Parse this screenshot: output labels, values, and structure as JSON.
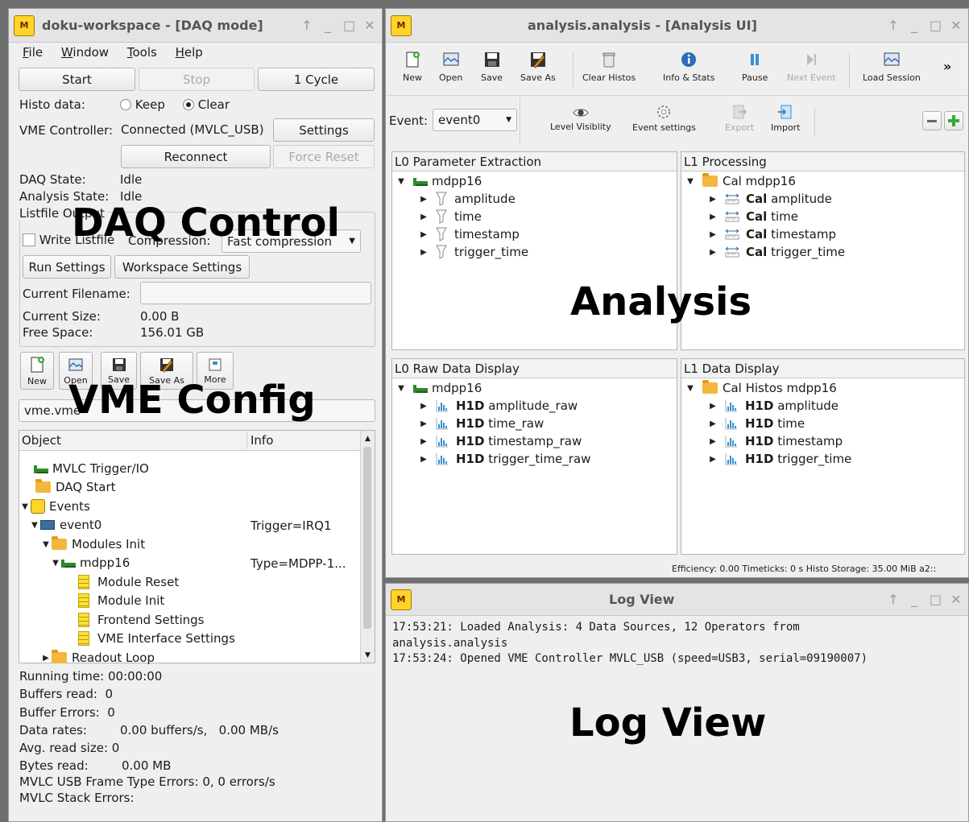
{
  "daq_window": {
    "title": "doku-workspace - [DAQ mode]",
    "logo": "MVME",
    "menu": [
      "File",
      "Window",
      "Tools",
      "Help"
    ],
    "start": "Start",
    "stop": "Stop",
    "one_cycle": "1 Cycle",
    "histo_label": "Histo data:",
    "keep": "Keep",
    "clear": "Clear",
    "vme_label": "VME Controller:",
    "vme_status": "Connected (MVLC_USB)",
    "settings": "Settings",
    "reconnect": "Reconnect",
    "force_reset": "Force Reset",
    "daq_state_label": "DAQ State:",
    "daq_state": "Idle",
    "analysis_state_label": "Analysis State:",
    "analysis_state": "Idle",
    "listfile_output": "Listfile Output",
    "overlay_daq": "DAQ Control",
    "write_listfile": "Write Listfile",
    "compression_label": "Compression:",
    "compression_value": "Fast compression",
    "run_settings": "Run Settings",
    "workspace_settings": "Workspace Settings",
    "current_filename_label": "Current Filename:",
    "current_filename": "",
    "current_size_label": "Current Size:",
    "current_size": "0.00 B",
    "free_space_label": "Free Space:",
    "free_space": "156.01 GB",
    "toolbar": [
      "New",
      "Open",
      "Save",
      "Save As",
      "More"
    ],
    "overlay_vme": "VME Config",
    "config_file": "vme.vme",
    "tree_header_object": "Object",
    "tree_header_info": "Info",
    "tree": [
      {
        "label": "MVLC Trigger/IO",
        "info": ""
      },
      {
        "label": "DAQ Start",
        "info": ""
      },
      {
        "label": "Events",
        "info": ""
      },
      {
        "label": "event0",
        "info": "Trigger=IRQ1"
      },
      {
        "label": "Modules Init",
        "info": ""
      },
      {
        "label": "mdpp16",
        "info": "Type=MDPP-1..."
      },
      {
        "label": "Module Reset",
        "info": ""
      },
      {
        "label": "Module Init",
        "info": ""
      },
      {
        "label": "Frontend Settings",
        "info": ""
      },
      {
        "label": "VME Interface Settings",
        "info": ""
      },
      {
        "label": "Readout Loop",
        "info": ""
      }
    ],
    "stats": [
      {
        "label": "Running time:",
        "value": "00:00:00"
      },
      {
        "label": "Buffers read:",
        "value": "0"
      },
      {
        "label": "Buffer Errors:",
        "value": "0"
      },
      {
        "label": "Data rates:",
        "value": "0.00 buffers/s,   0.00 MB/s"
      },
      {
        "label": "Avg. read size:",
        "value": "0"
      },
      {
        "label": "Bytes read:",
        "value": "0.00 MB"
      },
      {
        "label": "MVLC USB Frame Type Errors:",
        "value": "0, 0 errors/s"
      },
      {
        "label": "MVLC Stack Errors:",
        "value": ""
      }
    ]
  },
  "analysis_window": {
    "title": "analysis.analysis - [Analysis UI]",
    "toolbar": [
      "New",
      "Open",
      "Save",
      "Save As",
      "Clear Histos",
      "Info & Stats",
      "Pause",
      "Next Event",
      "Load Session"
    ],
    "more": "»",
    "event_label": "Event:",
    "event_value": "event0",
    "toolbar2": [
      "Level Visiblity",
      "Event settings",
      "Export",
      "Import"
    ],
    "overlay": "Analysis",
    "panels": {
      "l0_param": {
        "title": "L0 Parameter Extraction",
        "root": "mdpp16",
        "items": [
          "amplitude",
          "time",
          "timestamp",
          "trigger_time"
        ]
      },
      "l1_proc": {
        "title": "L1 Processing",
        "root": "Cal mdpp16",
        "prefix": "Cal",
        "items": [
          "amplitude",
          "time",
          "timestamp",
          "trigger_time"
        ]
      },
      "l0_raw": {
        "title": "L0 Raw Data Display",
        "root": "mdpp16",
        "prefix": "H1D",
        "items": [
          "amplitude_raw",
          "time_raw",
          "timestamp_raw",
          "trigger_time_raw"
        ]
      },
      "l1_display": {
        "title": "L1 Data Display",
        "root": "Cal Histos mdpp16",
        "prefix": "H1D",
        "items": [
          "amplitude",
          "time",
          "timestamp",
          "trigger_time"
        ]
      }
    },
    "status": "Efficiency: 0.00   Timeticks: 0 s   Histo Storage: 35.00 MiB   a2::"
  },
  "log_window": {
    "title": "Log View",
    "lines": [
      "17:53:21: Loaded Analysis: 4 Data Sources, 12 Operators from",
      "analysis.analysis",
      "17:53:24: Opened VME Controller MVLC_USB (speed=USB3, serial=09190007)"
    ],
    "overlay": "Log View"
  },
  "colors": {
    "window_bg": "#efefef",
    "module_green": "#2d8a2d",
    "folder_yellow": "#f4b63c",
    "info_blue": "#2a6fb8",
    "import_blue": "#3a8fd0",
    "plus_green": "#3aa83a"
  },
  "icons": {
    "new": "new-doc-icon",
    "open": "open-icon",
    "save": "floppy-icon",
    "save_as": "save-as-icon",
    "clear": "trash-icon",
    "info": "info-icon",
    "pause": "pause-icon",
    "next": "next-icon",
    "load": "load-session-icon",
    "eye": "eye-icon",
    "gear": "gear-icon",
    "export": "export-icon",
    "import": "import-icon",
    "minus": "minus-icon",
    "plus": "plus-icon"
  }
}
